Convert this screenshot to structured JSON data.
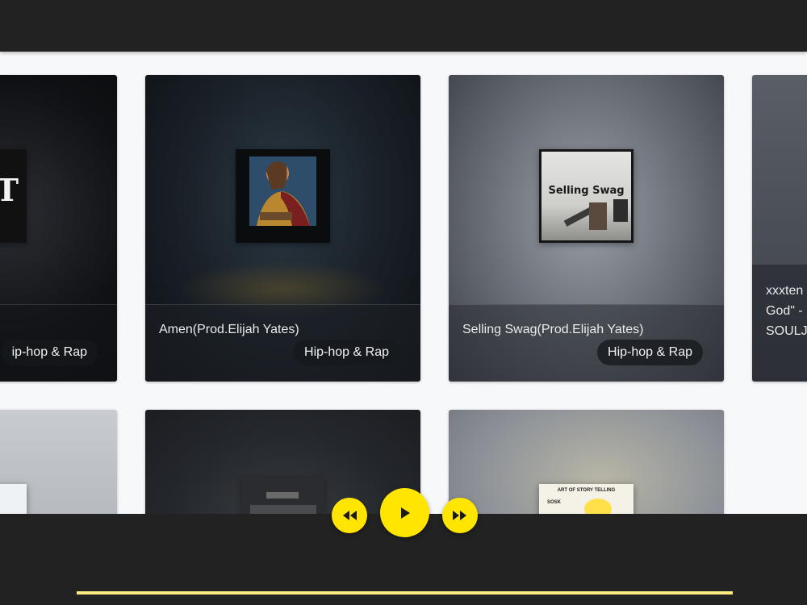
{
  "colors": {
    "accent": "#ffe500",
    "bar": "#222222",
    "progress": "#ffeb80"
  },
  "cards": [
    {
      "title": ")",
      "genre": "ip-hop & Rap"
    },
    {
      "title": "Amen(Prod.Elijah Yates)",
      "genre": "Hip-hop & Rap"
    },
    {
      "title": "Selling Swag(Prod.Elijah Yates)",
      "genre": "Hip-hop & Rap",
      "cover_text": "Selling Swag"
    },
    {
      "title_lines": [
        "xxxten",
        "God\" -",
        "SOULJ"
      ]
    },
    {
      "cover_text": "ART OF STORY TELLING",
      "cover_sub": "SOSK"
    }
  ],
  "player": {
    "previous_icon": "rewind-icon",
    "play_icon": "play-icon",
    "next_icon": "fast-forward-icon"
  }
}
